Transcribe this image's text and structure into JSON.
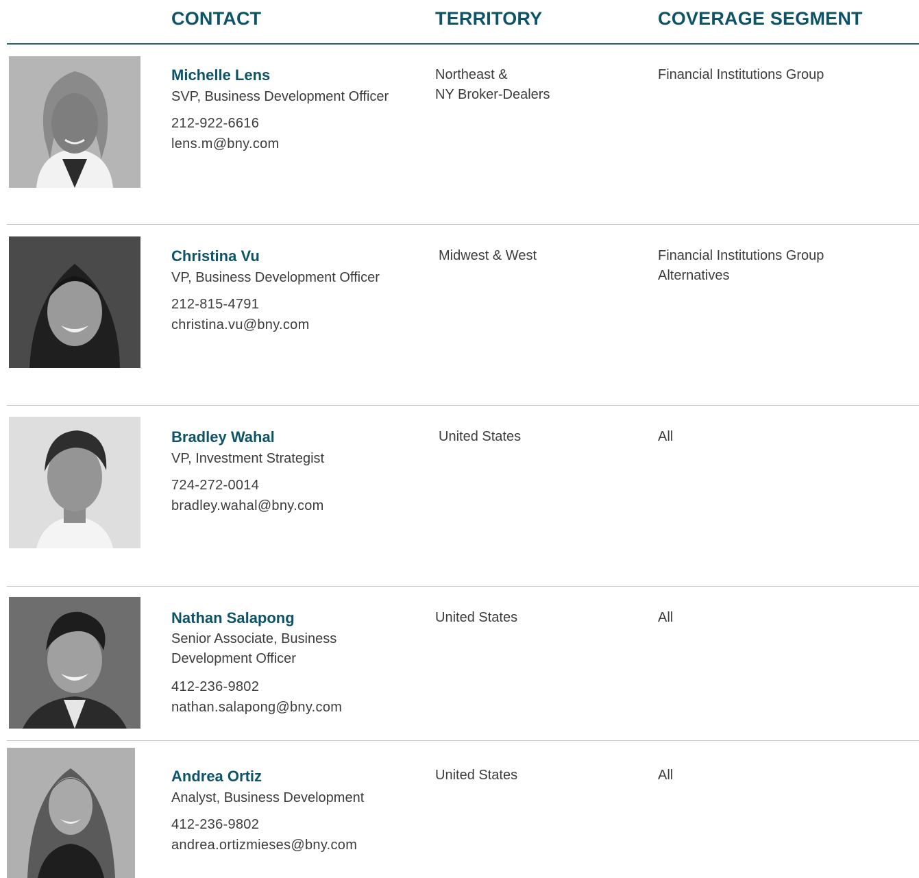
{
  "headers": {
    "contact": "CONTACT",
    "territory": "TERRITORY",
    "coverage_segment": "COVERAGE SEGMENT"
  },
  "contacts": [
    {
      "name": "Michelle Lens",
      "title": "SVP, Business Development Officer",
      "phone": "212-922-6616",
      "email": "lens.m@bny.com",
      "territory": [
        "Northeast &",
        "NY Broker-Dealers"
      ],
      "segment": [
        "Financial Institutions Group"
      ]
    },
    {
      "name": "Christina Vu",
      "title": "VP, Business Development Officer",
      "phone": "212-815-4791",
      "email": "christina.vu@bny.com",
      "territory": [
        "Midwest & West"
      ],
      "segment": [
        "Financial Institutions Group",
        "Alternatives"
      ]
    },
    {
      "name": "Bradley Wahal",
      "title": "VP, Investment Strategist",
      "phone": "724-272-0014",
      "email": "bradley.wahal@bny.com",
      "territory": [
        "United States"
      ],
      "segment": [
        "All"
      ]
    },
    {
      "name": "Nathan Salapong",
      "title": "Senior Associate, Business Development Officer",
      "phone": "412-236-9802",
      "email": "nathan.salapong@bny.com",
      "territory": [
        "United States"
      ],
      "segment": [
        "All"
      ]
    },
    {
      "name": "Andrea Ortiz",
      "title": "Analyst, Business Development",
      "phone": "412-236-9802",
      "email": "andrea.ortizmieses@bny.com",
      "territory": [
        "United States"
      ],
      "segment": [
        "All"
      ]
    }
  ]
}
